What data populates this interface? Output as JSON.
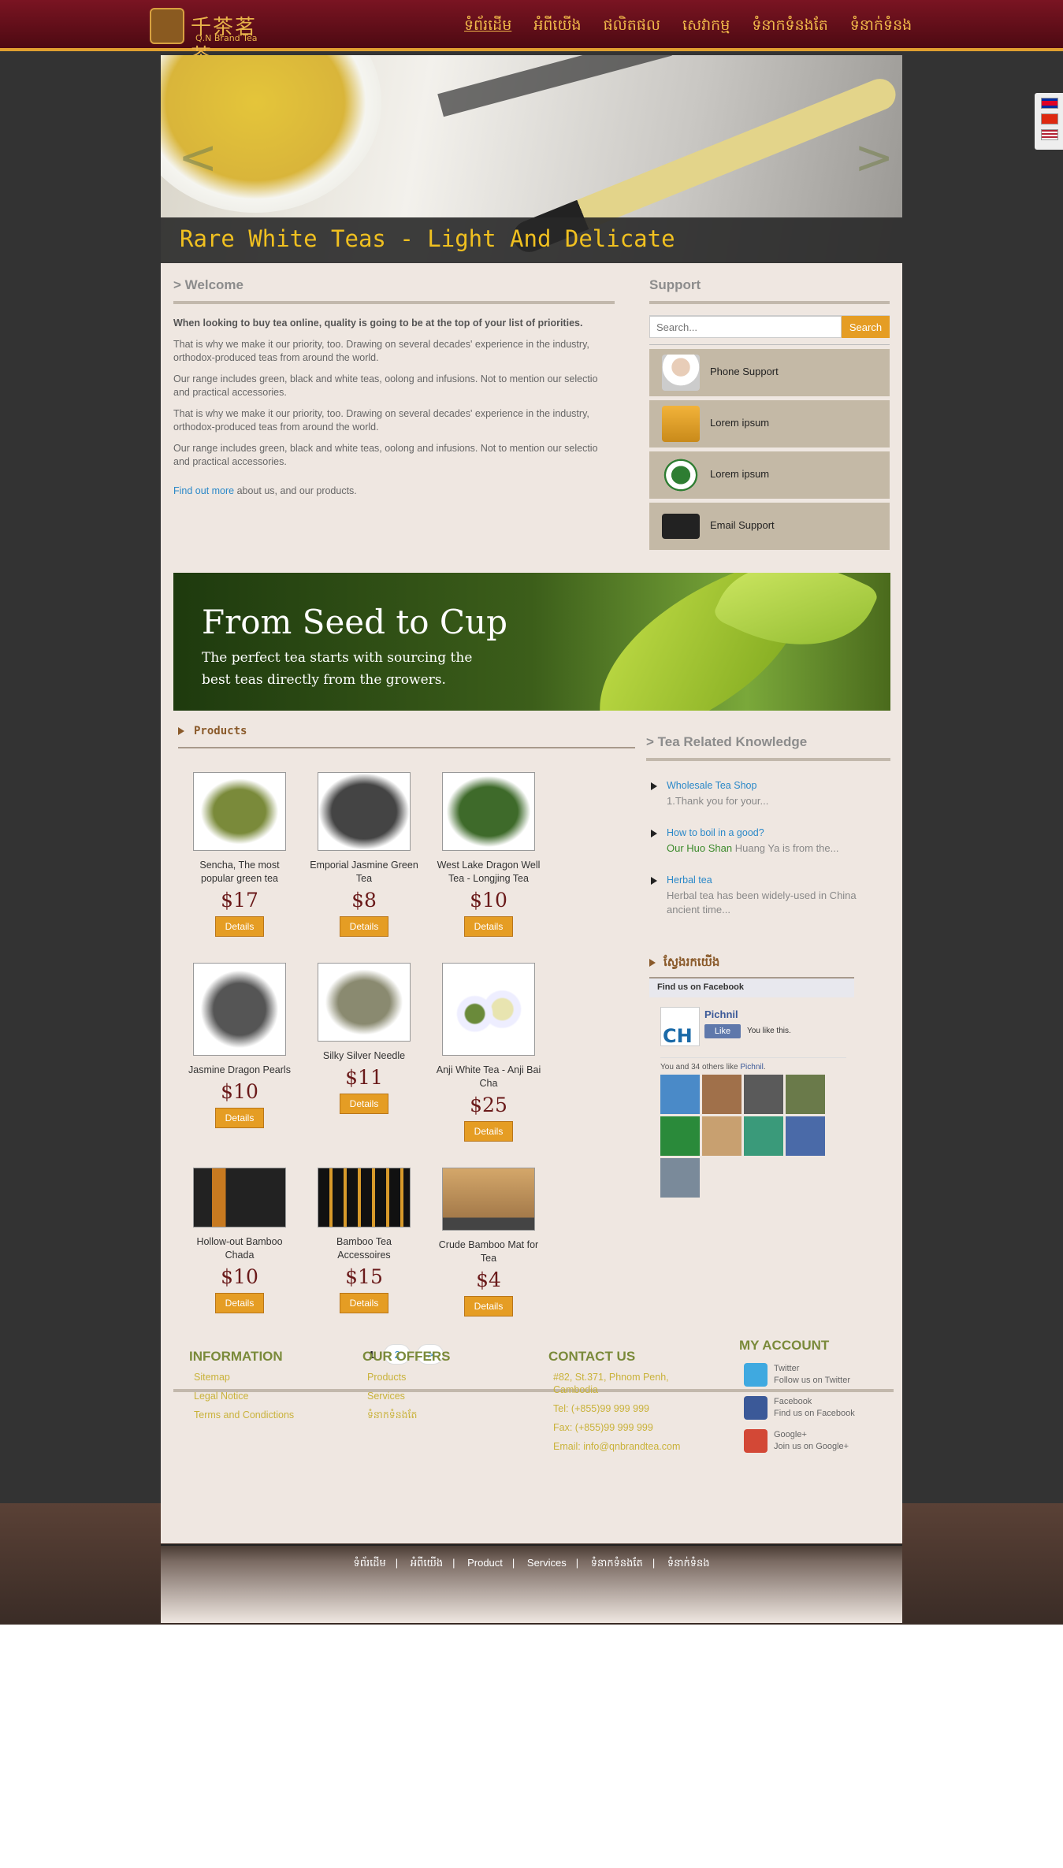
{
  "header": {
    "logo_cn": "千茶茗茶",
    "logo_en": "Q.N Brand Tea",
    "nav": [
      "ទំព័រដើម",
      "អំពីយើង",
      "ផលិតផល",
      "សេវាកម្ម",
      "ទំនាកទំនងតែ",
      "ទំនាក់ទំនង"
    ]
  },
  "slider": {
    "caption": "Rare White Teas - Light And Delicate",
    "prev": "<",
    "next": ">"
  },
  "welcome": {
    "title": "> Welcome",
    "lead": "When looking to buy tea online, quality is going to be at the top of your list of priorities.",
    "p1": "That is why we make it our priority, too. Drawing on several decades' experience in the industry, orthodox-produced teas from around the world.",
    "p2": "Our range includes green, black and white teas, oolong and infusions. Not to mention our selectio and practical accessories.",
    "p3": "That is why we make it our priority, too. Drawing on several decades' experience in the industry, orthodox-produced teas from around the world.",
    "p4": "Our range includes green, black and white teas, oolong and infusions. Not to mention our selectio and practical accessories.",
    "link": "Find out more",
    "link_tail": " about us, and our products."
  },
  "support": {
    "title": "Support",
    "search_placeholder": "Search...",
    "search_button": "Search",
    "items": [
      {
        "label": "Phone Support",
        "icon": "headset-person-icon"
      },
      {
        "label": "Lorem ipsum",
        "icon": "tea-bag-icon"
      },
      {
        "label": "Lorem ipsum",
        "icon": "tea-leaf-icon"
      },
      {
        "label": "Email Support",
        "icon": "envelope-icon"
      }
    ]
  },
  "banner": {
    "headline": "From Seed to Cup",
    "sub": "The perfect tea starts with sourcing the best teas directly from the growers."
  },
  "products": {
    "title": "Products",
    "details_label": "Details",
    "items": [
      {
        "name": "Sencha, The most popular green tea",
        "price": "$17"
      },
      {
        "name": "Emporial Jasmine Green Tea",
        "price": "$8"
      },
      {
        "name": "West Lake Dragon Well Tea - Longjing Tea",
        "price": "$10"
      },
      {
        "name": "Jasmine Dragon Pearls",
        "price": "$10"
      },
      {
        "name": "Silky Silver Needle",
        "price": "$11"
      },
      {
        "name": "Anji White Tea - Anji Bai Cha",
        "price": "$25"
      },
      {
        "name": "Hollow-out Bamboo Chada",
        "price": "$10"
      },
      {
        "name": "Bamboo Tea Accessoires",
        "price": "$15"
      },
      {
        "name": "Crude Bamboo Mat for Tea",
        "price": "$4"
      }
    ]
  },
  "pager": {
    "current": "1",
    "next_page": "2",
    "next": ">"
  },
  "knowledge": {
    "title": "> Tea Related Knowledge",
    "items": [
      {
        "title": "Wholesale Tea Shop",
        "desc": "1.Thank you for your..."
      },
      {
        "title": "How to boil in a good?",
        "desc_green": "Our Huo Shan",
        "desc": " Huang Ya is from the..."
      },
      {
        "title": "Herbal tea",
        "desc": "Herbal tea has been widely-used in China ancient time..."
      }
    ]
  },
  "findus": {
    "title": "ស្វែងរកយើង",
    "fb_header": "Find us on Facebook",
    "page_name": "Pichnil",
    "like": "Like",
    "you_like": "You like this.",
    "others_prefix": "You and 34 others like ",
    "others_link": "Pichnil",
    "others_suffix": "."
  },
  "footer": {
    "information": {
      "title": "INFORMATION",
      "links": [
        "Sitemap",
        "Legal Notice",
        "Terms and Condictions"
      ]
    },
    "offers": {
      "title": "OUR OFFERS",
      "links": [
        "Products",
        "Services",
        "ទំនាកទំនងតែ"
      ]
    },
    "contact": {
      "title": "CONTACT US",
      "lines": [
        "#82, St.371, Phnom Penh, Cambodia",
        "Tel: (+855)99 999 999",
        "Fax: (+855)99 999 999",
        "Email: info@qnbrandtea.com"
      ]
    },
    "account": {
      "title": "MY ACCOUNT",
      "social": [
        {
          "name": "Twitter",
          "sub": "Follow us on Twitter",
          "icon": "twitter-icon",
          "color": "#3fa9e0"
        },
        {
          "name": "Facebook",
          "sub": "Find us on Facebook",
          "icon": "facebook-icon",
          "color": "#3b5998"
        },
        {
          "name": "Google+",
          "sub": "Join us on Google+",
          "icon": "google-plus-icon",
          "color": "#d34836"
        }
      ]
    },
    "bottom_nav": [
      "ទំព័រដើម",
      "អំពីយើង",
      "Product",
      "Services",
      "ទំនាកទំនងតែ",
      "ទំនាក់ទំនង"
    ],
    "separator": "|"
  }
}
